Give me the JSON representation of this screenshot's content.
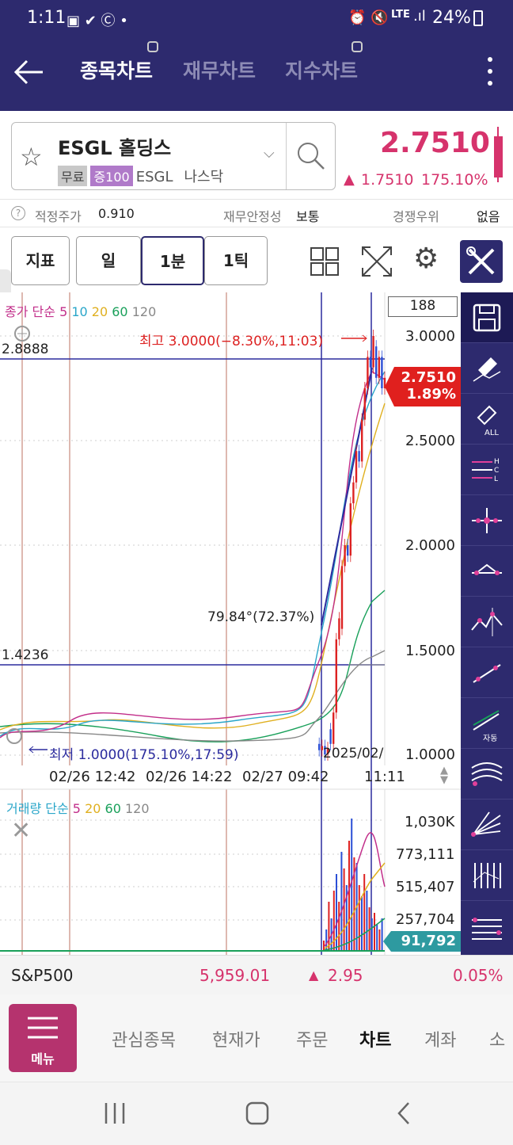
{
  "status": {
    "time": "1:11",
    "lte": "LTE",
    "battery": "24%"
  },
  "header": {
    "tabs": [
      {
        "label": "종목차트"
      },
      {
        "label": "재무차트"
      },
      {
        "label": "지수차트"
      }
    ]
  },
  "stock": {
    "name": "ESGL 홀딩스",
    "badges": [
      "무료",
      "증100"
    ],
    "code": "ESGL",
    "market": "나스닥",
    "price": "2.7510",
    "change": "1.7510",
    "change_pct": "175.10%",
    "colors": {
      "up": "#d6336c",
      "brand": "#2d2a6e",
      "menu": "#b5336e"
    }
  },
  "info": {
    "fair_label": "적정주가",
    "fair_value": "0.910",
    "stability_label": "재무안정성",
    "stability_value": "보통",
    "competition_label": "경쟁우위",
    "competition_value": "없음"
  },
  "toolbar": {
    "indicator": "지표",
    "day": "일",
    "min1": "1분",
    "tick1": "1틱"
  },
  "chart": {
    "legend_prefix": "종가 단순",
    "legend_ma": [
      "5",
      "10",
      "20",
      "60",
      "120"
    ],
    "count_box": "188",
    "hline1": "2.8888",
    "hline2": "1.4236",
    "high_label": "최고 3.0000(−8.30%,11:03)",
    "low_label": "최저 1.0000(175.10%,17:59)",
    "angle_label": "79.84°(72.37%)",
    "year_label": "2025/02/",
    "price_tag": "2.7510",
    "price_tag_pct": "1.89%",
    "yaxis": [
      "3.0000",
      "2.5000",
      "2.0000",
      "1.5000",
      "1.0000"
    ],
    "xaxis": [
      "02/26 12:42",
      "02/26 14:22",
      "02/27 09:42",
      "11:11"
    ]
  },
  "volume": {
    "legend_prefix": "거래량 단순",
    "legend_ma": [
      "5",
      "20",
      "60",
      "120"
    ],
    "yaxis": [
      "1,030K",
      "773,111",
      "515,407",
      "257,704"
    ],
    "last": "91,792"
  },
  "ticker": {
    "name": "S&P500",
    "value": "5,959.01",
    "change": "2.95",
    "pct": "0.05%"
  },
  "menu": {
    "button": "메뉴",
    "items": [
      "관심종목",
      "현재가",
      "주문",
      "차트",
      "계좌",
      "소"
    ]
  }
}
